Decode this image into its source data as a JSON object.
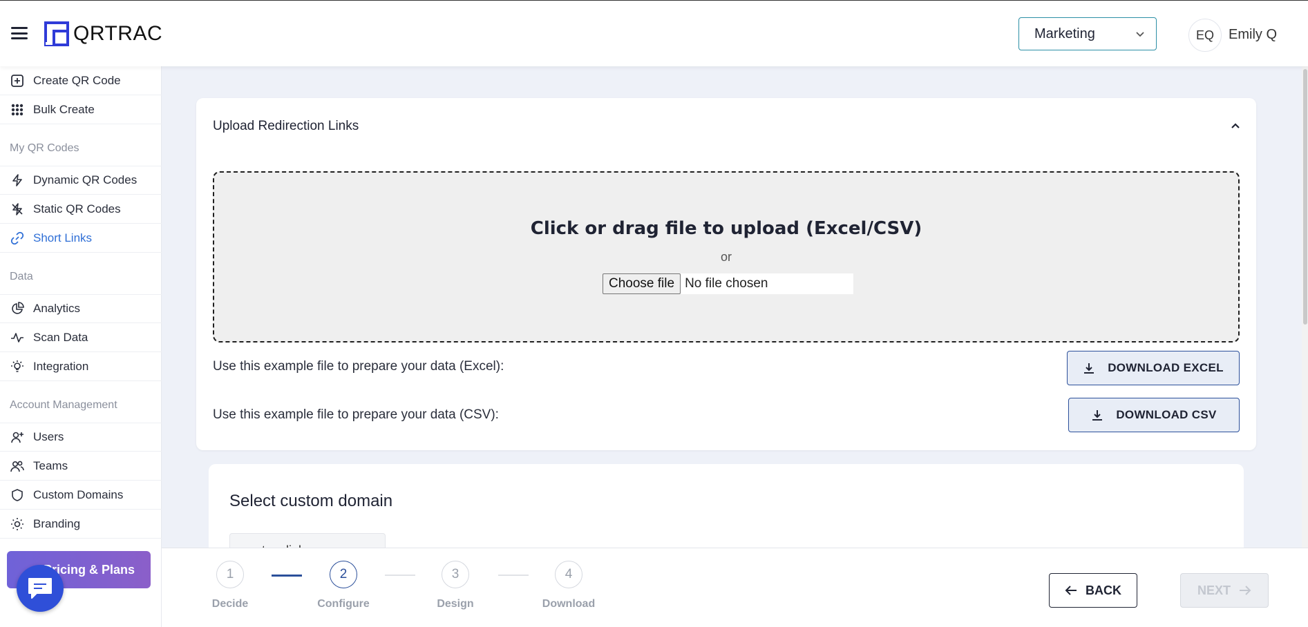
{
  "header": {
    "brand": "QRTRAC",
    "workspace": "Marketing",
    "user_initials": "EQ",
    "user_name": "Emily Q"
  },
  "sidebar": {
    "items_top": [
      {
        "label": "Create QR Code",
        "icon": "plus-square-icon"
      },
      {
        "label": "Bulk Create",
        "icon": "grid-dots-icon"
      }
    ],
    "section_qr": "My QR Codes",
    "items_qr": [
      {
        "label": "Dynamic QR Codes",
        "icon": "lightning-icon"
      },
      {
        "label": "Static QR Codes",
        "icon": "lightning-off-icon"
      },
      {
        "label": "Short Links",
        "icon": "link-icon",
        "active": true
      }
    ],
    "section_data": "Data",
    "items_data": [
      {
        "label": "Analytics",
        "icon": "pie-chart-icon"
      },
      {
        "label": "Scan Data",
        "icon": "activity-icon"
      },
      {
        "label": "Integration",
        "icon": "bulb-icon"
      }
    ],
    "section_account": "Account Management",
    "items_account": [
      {
        "label": "Users",
        "icon": "user-plus-icon"
      },
      {
        "label": "Teams",
        "icon": "users-icon"
      },
      {
        "label": "Custom Domains",
        "icon": "shield-icon"
      },
      {
        "label": "Branding",
        "icon": "sun-icon"
      }
    ],
    "pricing_label": "Pricing & Plans"
  },
  "upload": {
    "title": "Upload Redirection Links",
    "dropzone_title": "Click or drag file to upload (Excel/CSV)",
    "or_text": "or",
    "choose_file": "Choose file",
    "no_file": "No file chosen",
    "excel_text": "Use this example file to prepare your data (Excel):",
    "excel_button": "DOWNLOAD EXCEL",
    "csv_text": "Use this example file to prepare your data (CSV):",
    "csv_button": "DOWNLOAD CSV"
  },
  "domain": {
    "title": "Select custom domain",
    "value": "qrtrac.link"
  },
  "stepper": {
    "steps": [
      {
        "number": "1",
        "label": "Decide"
      },
      {
        "number": "2",
        "label": "Configure"
      },
      {
        "number": "3",
        "label": "Design"
      },
      {
        "number": "4",
        "label": "Download"
      }
    ],
    "current_step": 2,
    "back_label": "BACK",
    "next_label": "NEXT"
  },
  "colors": {
    "accent": "#2b4f9a",
    "active_nav": "#2f6fd6",
    "pricing_gradient_start": "#6f62d8",
    "pricing_gradient_end": "#8b5fc9"
  }
}
